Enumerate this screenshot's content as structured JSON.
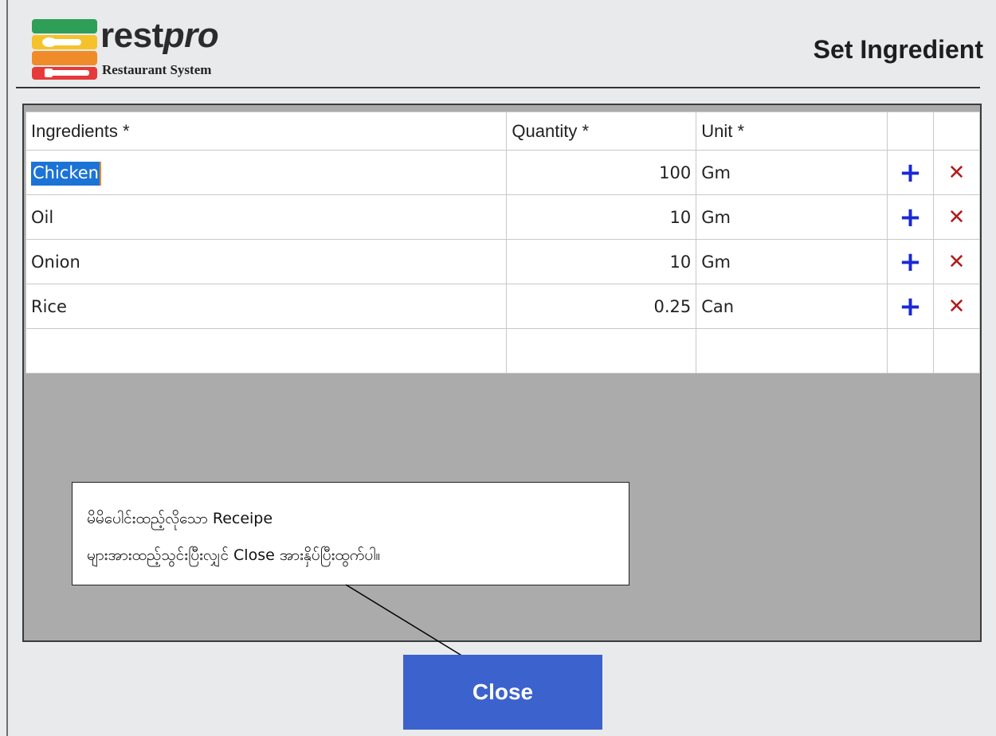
{
  "logo": {
    "word_rest": "rest",
    "word_pro": "pro",
    "subtitle": "Restaurant System",
    "icon": "restaurant-cutlery-icon",
    "colors": [
      "#2f9e57",
      "#f6c22c",
      "#f08b2a",
      "#e63a3a"
    ]
  },
  "page": {
    "title": "Set Ingredient"
  },
  "grid": {
    "headers": {
      "ingredients": "Ingredients *",
      "quantity": "Quantity *",
      "unit": "Unit *"
    },
    "rows": [
      {
        "ingredient": "Chicken",
        "quantity": "100",
        "unit": "Gm"
      },
      {
        "ingredient": "Oil",
        "quantity": "10",
        "unit": "Gm"
      },
      {
        "ingredient": "Onion",
        "quantity": "10",
        "unit": "Gm"
      },
      {
        "ingredient": "Rice",
        "quantity": "0.25",
        "unit": "Can"
      }
    ],
    "add_symbol": "+",
    "delete_symbol": "✕",
    "add_color": "#1a28d6",
    "delete_color": "#b01c1c"
  },
  "callout": {
    "line1": "မိမိပေါင်းထည့်လိုသော Receipe",
    "line2": "များအားထည့်သွင်းပြီးလျှင် Close အားနှိပ်ပြီးထွက်ပါ။"
  },
  "close_button": {
    "label": "Close",
    "color": "#3c62cd"
  }
}
